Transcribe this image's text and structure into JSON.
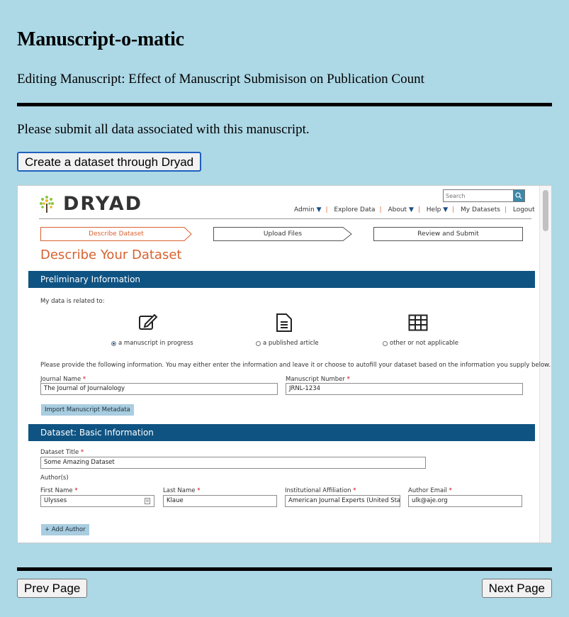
{
  "app": {
    "title": "Manuscript-o-matic",
    "subtitle": "Editing Manuscript: Effect of Manuscript Submisison on Publication Count",
    "instruction": "Please submit all data associated with this manuscript.",
    "create_button": "Create a dataset through Dryad",
    "prev_button": "Prev Page",
    "next_button": "Next Page"
  },
  "dryad": {
    "logo_text": "DRYAD",
    "search_placeholder": "Search",
    "nav": {
      "admin": "Admin",
      "explore": "Explore Data",
      "about": "About",
      "help": "Help",
      "my_datasets": "My Datasets",
      "logout": "Logout"
    },
    "steps": [
      "Describe Dataset",
      "Upload Files",
      "Review and Submit"
    ],
    "page_heading": "Describe Your Dataset",
    "prelim": {
      "header": "Preliminary Information",
      "related_label": "My data is related to:",
      "options": [
        "a manuscript in progress",
        "a published article",
        "other or not applicable"
      ],
      "selected": "a manuscript in progress",
      "instructions": "Please provide the following information. You may either enter the information and leave it or choose to autofill your dataset based on the information you supply below.",
      "journal_label": "Journal Name",
      "journal_value": "The Journal of Journalology",
      "manuscript_label": "Manuscript Number",
      "manuscript_value": "JRNL-1234",
      "import_button": "Import Manuscript Metadata"
    },
    "basic": {
      "header": "Dataset: Basic Information",
      "title_label": "Dataset Title",
      "title_value": "Some Amazing Dataset",
      "authors_label": "Author(s)",
      "first_name_label": "First Name",
      "first_name_value": "Ulysses",
      "last_name_label": "Last Name",
      "last_name_value": "Klaue",
      "affiliation_label": "Institutional Affiliation",
      "affiliation_value": "American Journal Experts (United States)",
      "email_label": "Author Email",
      "email_value": "ulk@aje.org",
      "add_author_button": "+ Add Author"
    },
    "required_mark": "*"
  }
}
